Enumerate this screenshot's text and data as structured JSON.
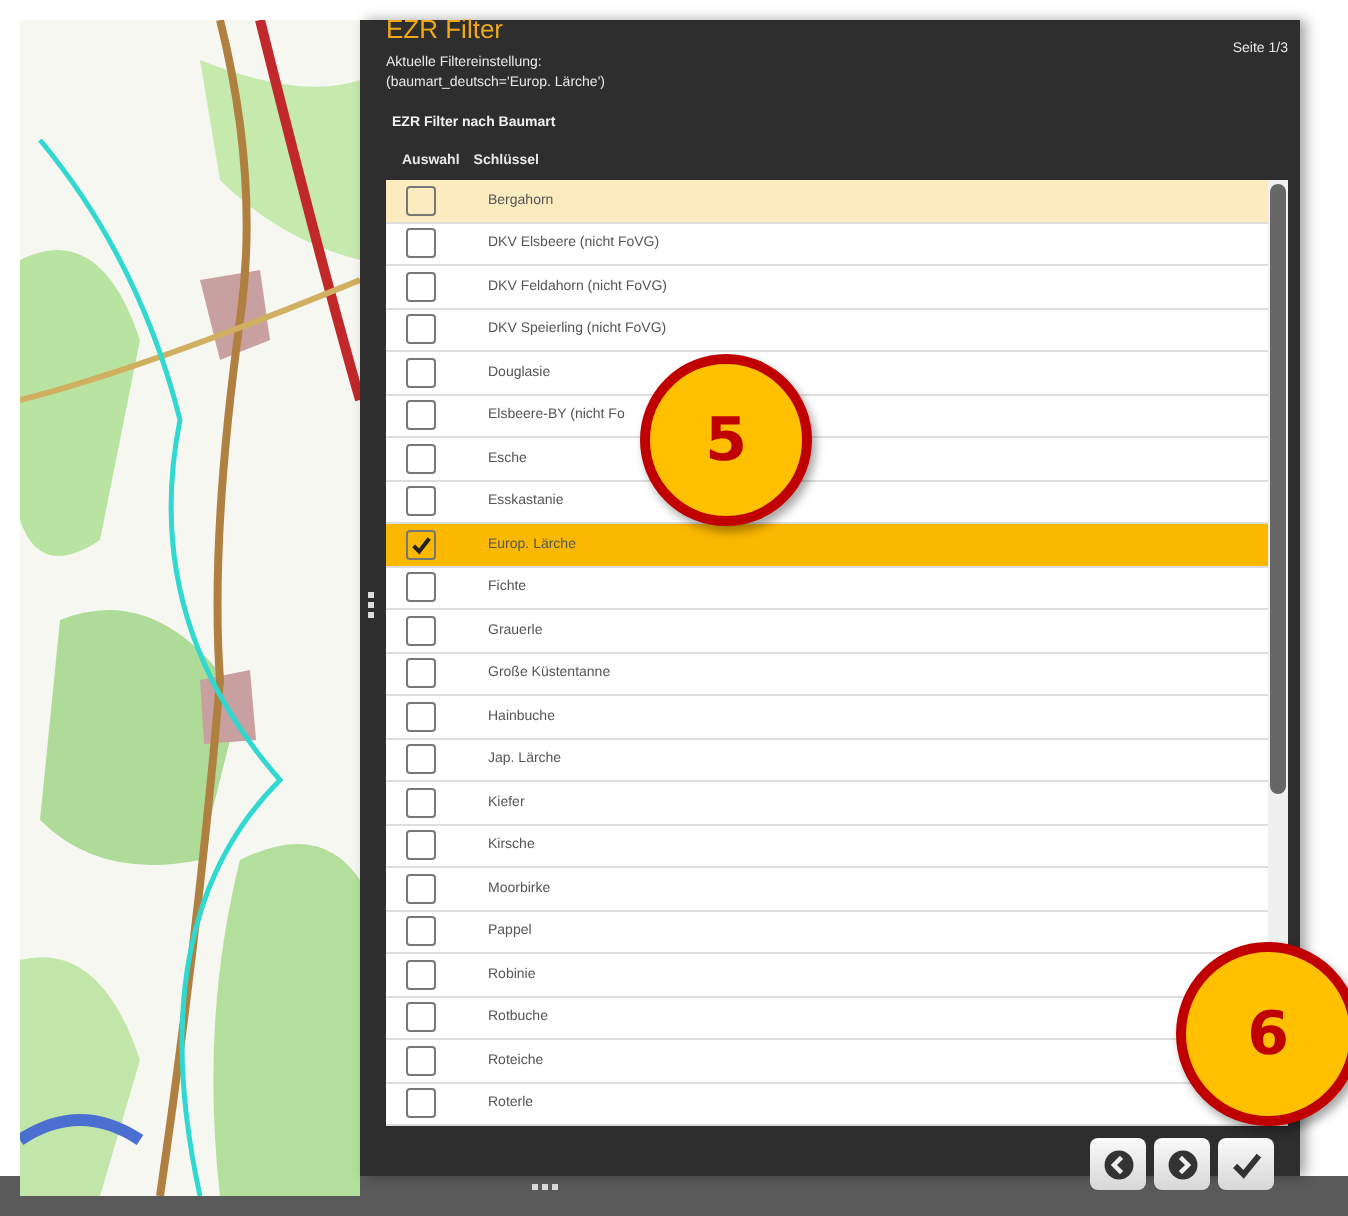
{
  "panel": {
    "title": "EZR Filter",
    "page": "Seite 1/3",
    "current_filter_label": "Aktuelle Filtereinstellung:",
    "current_filter": "(baumart_deutsch='Europ. Lärche')",
    "section_title": "EZR Filter nach Baumart"
  },
  "table": {
    "columns": [
      "Auswahl",
      "Schlüssel"
    ],
    "rows": [
      {
        "label": "Bergahorn",
        "checked": false,
        "selected": false,
        "hovered": true
      },
      {
        "label": "DKV Elsbeere (nicht FoVG)",
        "checked": false,
        "selected": false,
        "hovered": false
      },
      {
        "label": "DKV Feldahorn (nicht FoVG)",
        "checked": false,
        "selected": false,
        "hovered": false
      },
      {
        "label": "DKV Speierling (nicht FoVG)",
        "checked": false,
        "selected": false,
        "hovered": false
      },
      {
        "label": "Douglasie",
        "checked": false,
        "selected": false,
        "hovered": false
      },
      {
        "label": "Elsbeere-BY (nicht Fo",
        "checked": false,
        "selected": false,
        "hovered": false
      },
      {
        "label": "Esche",
        "checked": false,
        "selected": false,
        "hovered": false
      },
      {
        "label": "Esskastanie",
        "checked": false,
        "selected": false,
        "hovered": false
      },
      {
        "label": "Europ. Lärche",
        "checked": true,
        "selected": true,
        "hovered": false
      },
      {
        "label": "Fichte",
        "checked": false,
        "selected": false,
        "hovered": false
      },
      {
        "label": "Grauerle",
        "checked": false,
        "selected": false,
        "hovered": false
      },
      {
        "label": "Große Küstentanne",
        "checked": false,
        "selected": false,
        "hovered": false
      },
      {
        "label": "Hainbuche",
        "checked": false,
        "selected": false,
        "hovered": false
      },
      {
        "label": "Jap. Lärche",
        "checked": false,
        "selected": false,
        "hovered": false
      },
      {
        "label": "Kiefer",
        "checked": false,
        "selected": false,
        "hovered": false
      },
      {
        "label": "Kirsche",
        "checked": false,
        "selected": false,
        "hovered": false
      },
      {
        "label": "Moorbirke",
        "checked": false,
        "selected": false,
        "hovered": false
      },
      {
        "label": "Pappel",
        "checked": false,
        "selected": false,
        "hovered": false
      },
      {
        "label": "Robinie",
        "checked": false,
        "selected": false,
        "hovered": false
      },
      {
        "label": "Rotbuche",
        "checked": false,
        "selected": false,
        "hovered": false
      },
      {
        "label": "Roteiche",
        "checked": false,
        "selected": false,
        "hovered": false
      },
      {
        "label": "Roterle",
        "checked": false,
        "selected": false,
        "hovered": false
      }
    ]
  },
  "callouts": [
    {
      "number": "5"
    },
    {
      "number": "6"
    }
  ]
}
